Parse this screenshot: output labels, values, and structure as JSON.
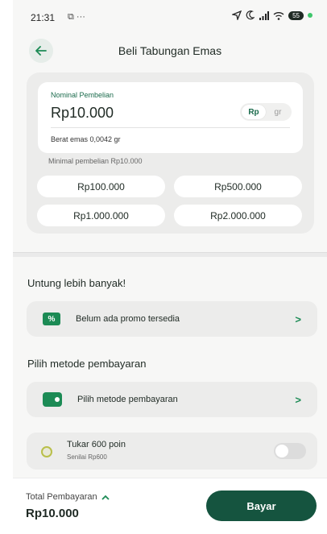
{
  "status_bar": {
    "time": "21:31",
    "extra": "⧉ ···",
    "battery": "55"
  },
  "header": {
    "title": "Beli Tabungan Emas"
  },
  "amount": {
    "label": "Nominal Pembelian",
    "value": "Rp10.000",
    "unit_options": [
      "Rp",
      "gr"
    ],
    "unit_selected": "Rp",
    "gold_weight": "Berat emas 0,0042 gr",
    "minimum": "Minimal pembelian Rp10.000",
    "presets": [
      "Rp100.000",
      "Rp500.000",
      "Rp1.000.000",
      "Rp2.000.000"
    ]
  },
  "promo": {
    "section_title": "Untung lebih banyak!",
    "label": "Belum ada promo tersedia",
    "icon": "percent-ticket-icon"
  },
  "payment": {
    "section_title": "Pilih metode pembayaran",
    "label": "Pilih metode pembayaran",
    "icon": "wallet-icon"
  },
  "points": {
    "title": "Tukar 600 poin",
    "subtitle": "Senilai Rp600",
    "enabled": false
  },
  "footer": {
    "total_label": "Total Pembayaran",
    "total_value": "Rp10.000",
    "pay_label": "Bayar"
  },
  "colors": {
    "accent": "#1c8b55",
    "primary_button": "#15543f"
  }
}
